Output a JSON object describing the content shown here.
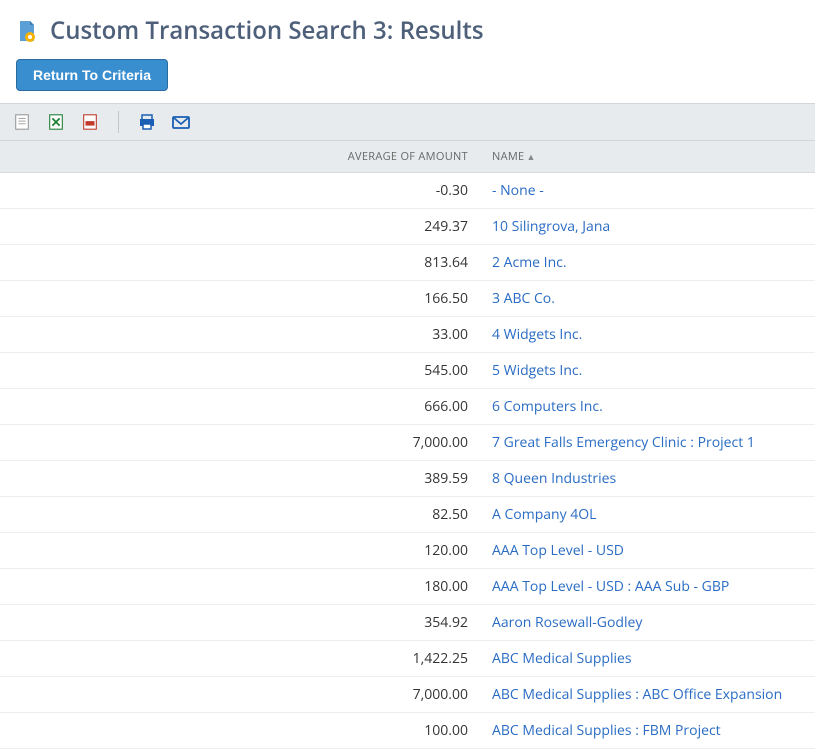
{
  "header": {
    "title": "Custom Transaction Search 3: Results"
  },
  "buttons": {
    "return_to_criteria": "Return To Criteria"
  },
  "table": {
    "columns": {
      "amount": "Average of Amount",
      "name": "Name"
    },
    "sort_indicator": "▲",
    "rows": [
      {
        "amount": "-0.30",
        "name": "- None -"
      },
      {
        "amount": "249.37",
        "name": "10 Silingrova, Jana"
      },
      {
        "amount": "813.64",
        "name": "2 Acme Inc."
      },
      {
        "amount": "166.50",
        "name": "3 ABC Co."
      },
      {
        "amount": "33.00",
        "name": "4 Widgets Inc."
      },
      {
        "amount": "545.00",
        "name": "5 Widgets Inc."
      },
      {
        "amount": "666.00",
        "name": "6 Computers Inc."
      },
      {
        "amount": "7,000.00",
        "name": "7 Great Falls Emergency Clinic : Project 1"
      },
      {
        "amount": "389.59",
        "name": "8 Queen Industries"
      },
      {
        "amount": "82.50",
        "name": "A Company 4OL"
      },
      {
        "amount": "120.00",
        "name": "AAA Top Level - USD"
      },
      {
        "amount": "180.00",
        "name": "AAA Top Level - USD : AAA Sub - GBP"
      },
      {
        "amount": "354.92",
        "name": "Aaron Rosewall-Godley"
      },
      {
        "amount": "1,422.25",
        "name": "ABC Medical Supplies"
      },
      {
        "amount": "7,000.00",
        "name": "ABC Medical Supplies : ABC Office Expansion"
      },
      {
        "amount": "100.00",
        "name": "ABC Medical Supplies : FBM Project"
      }
    ]
  }
}
